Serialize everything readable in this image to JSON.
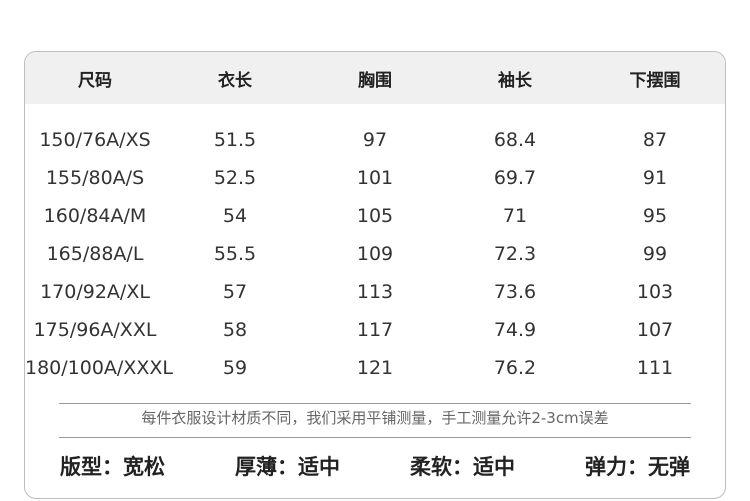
{
  "table": {
    "headers": [
      "尺码",
      "衣长",
      "胸围",
      "袖长",
      "下摆围"
    ],
    "rows": [
      [
        "150/76A/XS",
        "51.5",
        "97",
        "68.4",
        "87"
      ],
      [
        "155/80A/S",
        "52.5",
        "101",
        "69.7",
        "91"
      ],
      [
        "160/84A/M",
        "54",
        "105",
        "71",
        "95"
      ],
      [
        "165/88A/L",
        "55.5",
        "109",
        "72.3",
        "99"
      ],
      [
        "170/92A/XL",
        "57",
        "113",
        "73.6",
        "103"
      ],
      [
        "175/96A/XXL",
        "58",
        "117",
        "74.9",
        "107"
      ],
      [
        "180/100A/XXXL",
        "59",
        "121",
        "76.2",
        "111"
      ]
    ]
  },
  "note": "每件衣服设计材质不同，我们采用平铺测量，手工测量允许2-3cm误差",
  "properties": [
    "版型：宽松",
    "厚薄：适中",
    "柔软：适中",
    "弹力：无弹"
  ]
}
